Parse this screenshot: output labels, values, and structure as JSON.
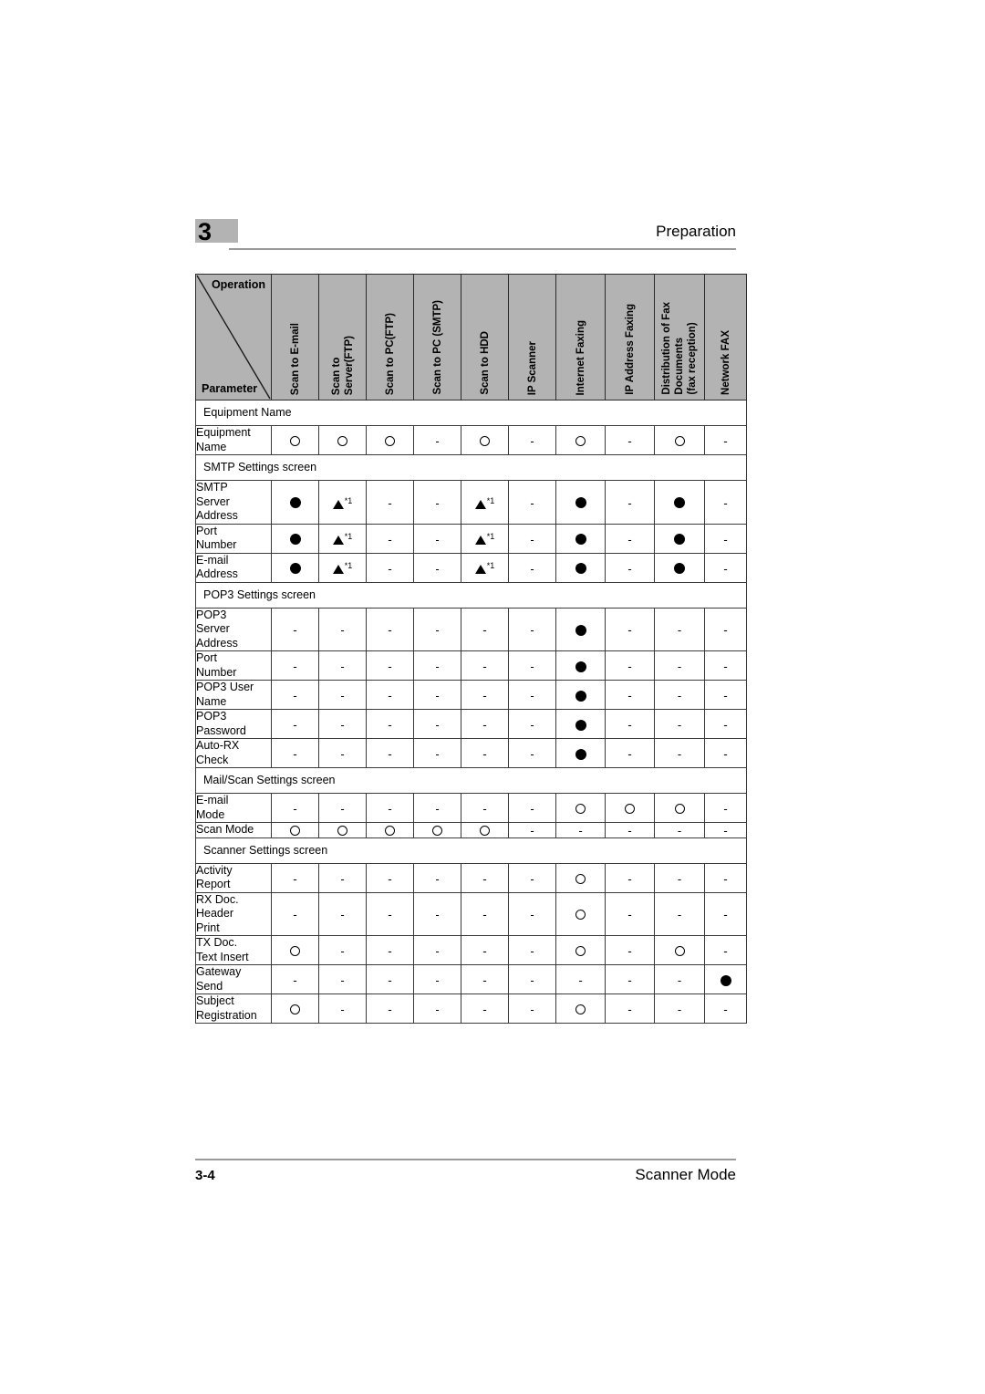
{
  "page": {
    "chapter_number": "3",
    "running_head": "Preparation",
    "footer_page": "3-4",
    "footer_title": "Scanner Mode",
    "header_bg_color": "#b3b3b3",
    "rule_color": "#9a9a9a"
  },
  "table": {
    "corner": {
      "top_label": "Operation",
      "bottom_label": "Parameter"
    },
    "columns": [
      "Scan to E-mail",
      "Scan to\nServer(FTP)",
      "Scan to PC(FTP)",
      "Scan to PC (SMTP)",
      "Scan to HDD",
      "IP Scanner",
      "Internet Faxing",
      "IP Address Faxing",
      "Distribution of Fax\nDocuments\n(fax reception)",
      "Network FAX"
    ],
    "symbol_legend": {
      "open": "○",
      "filled": "●",
      "triangle": "▲",
      "triangle_note": "*1",
      "dash": "-"
    },
    "rows": [
      {
        "kind": "section",
        "label": "Equipment Name"
      },
      {
        "kind": "data",
        "label": "Equipment\nName",
        "marks": [
          "open",
          "open",
          "open",
          "dash",
          "open",
          "dash",
          "open",
          "dash",
          "open",
          "dash"
        ]
      },
      {
        "kind": "section",
        "label": "SMTP Settings screen"
      },
      {
        "kind": "data",
        "label": "SMTP\nServer\nAddress",
        "marks": [
          "filled",
          "tri",
          "dash",
          "dash",
          "tri",
          "dash",
          "filled",
          "dash",
          "filled",
          "dash"
        ]
      },
      {
        "kind": "data",
        "label": "Port\nNumber",
        "marks": [
          "filled",
          "tri",
          "dash",
          "dash",
          "tri",
          "dash",
          "filled",
          "dash",
          "filled",
          "dash"
        ]
      },
      {
        "kind": "data",
        "label": "E-mail\nAddress",
        "marks": [
          "filled",
          "tri",
          "dash",
          "dash",
          "tri",
          "dash",
          "filled",
          "dash",
          "filled",
          "dash"
        ]
      },
      {
        "kind": "section",
        "label": "POP3 Settings screen"
      },
      {
        "kind": "data",
        "label": "POP3\nServer\nAddress",
        "marks": [
          "dash",
          "dash",
          "dash",
          "dash",
          "dash",
          "dash",
          "filled",
          "dash",
          "dash",
          "dash"
        ]
      },
      {
        "kind": "data",
        "label": "Port\nNumber",
        "marks": [
          "dash",
          "dash",
          "dash",
          "dash",
          "dash",
          "dash",
          "filled",
          "dash",
          "dash",
          "dash"
        ]
      },
      {
        "kind": "data",
        "label": "POP3 User\nName",
        "marks": [
          "dash",
          "dash",
          "dash",
          "dash",
          "dash",
          "dash",
          "filled",
          "dash",
          "dash",
          "dash"
        ]
      },
      {
        "kind": "data",
        "label": "POP3\nPassword",
        "marks": [
          "dash",
          "dash",
          "dash",
          "dash",
          "dash",
          "dash",
          "filled",
          "dash",
          "dash",
          "dash"
        ]
      },
      {
        "kind": "data",
        "label": "Auto-RX\nCheck",
        "marks": [
          "dash",
          "dash",
          "dash",
          "dash",
          "dash",
          "dash",
          "filled",
          "dash",
          "dash",
          "dash"
        ]
      },
      {
        "kind": "section",
        "label": "Mail/Scan Settings screen"
      },
      {
        "kind": "data",
        "label": "E-mail\nMode",
        "marks": [
          "dash",
          "dash",
          "dash",
          "dash",
          "dash",
          "dash",
          "open",
          "open",
          "open",
          "dash"
        ]
      },
      {
        "kind": "data",
        "label": "Scan Mode",
        "marks": [
          "open",
          "open",
          "open",
          "open",
          "open",
          "dash",
          "dash",
          "dash",
          "dash",
          "dash"
        ]
      },
      {
        "kind": "section",
        "label": "Scanner Settings screen"
      },
      {
        "kind": "data",
        "label": "Activity\nReport",
        "marks": [
          "dash",
          "dash",
          "dash",
          "dash",
          "dash",
          "dash",
          "open",
          "dash",
          "dash",
          "dash"
        ]
      },
      {
        "kind": "data",
        "label": "RX Doc.\nHeader\nPrint",
        "marks": [
          "dash",
          "dash",
          "dash",
          "dash",
          "dash",
          "dash",
          "open",
          "dash",
          "dash",
          "dash"
        ]
      },
      {
        "kind": "data",
        "label": "TX Doc.\nText Insert",
        "marks": [
          "open",
          "dash",
          "dash",
          "dash",
          "dash",
          "dash",
          "open",
          "dash",
          "open",
          "dash"
        ]
      },
      {
        "kind": "data",
        "label": "Gateway\nSend",
        "marks": [
          "dash",
          "dash",
          "dash",
          "dash",
          "dash",
          "dash",
          "dash",
          "dash",
          "dash",
          "filled"
        ]
      },
      {
        "kind": "data",
        "label": "Subject\nRegistration",
        "marks": [
          "open",
          "dash",
          "dash",
          "dash",
          "dash",
          "dash",
          "open",
          "dash",
          "dash",
          "dash"
        ]
      }
    ]
  }
}
